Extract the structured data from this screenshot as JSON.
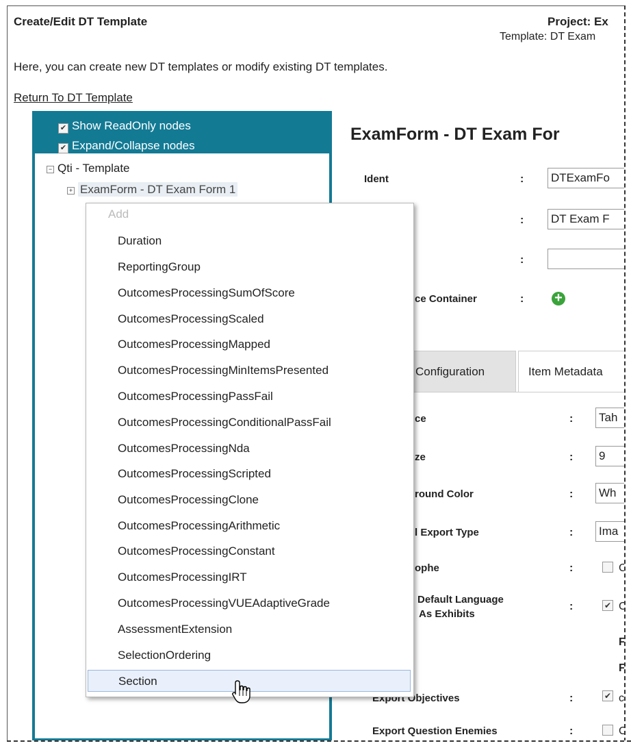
{
  "page": {
    "title": "Create/Edit DT Template",
    "project_label": "Project: Ex",
    "template_label": "Template: DT Exam",
    "description": "Here, you can create new DT templates or modify existing DT templates.",
    "return_link": "Return To DT Template"
  },
  "tree": {
    "show_readonly": "Show ReadOnly nodes",
    "expand_collapse": "Expand/Collapse nodes",
    "root_node": "Qti - Template",
    "child_node": "ExamForm - DT Exam Form 1"
  },
  "context_menu": {
    "header": "Add",
    "items": [
      "Duration",
      "ReportingGroup",
      "OutcomesProcessingSumOfScore",
      "OutcomesProcessingScaled",
      "OutcomesProcessingMapped",
      "OutcomesProcessingMinItemsPresented",
      "OutcomesProcessingPassFail",
      "OutcomesProcessingConditionalPassFail",
      "OutcomesProcessingNda",
      "OutcomesProcessingScripted",
      "OutcomesProcessingClone",
      "OutcomesProcessingArithmetic",
      "OutcomesProcessingConstant",
      "OutcomesProcessingIRT",
      "OutcomesProcessingVUEAdaptiveGrade",
      "AssessmentExtension",
      "SelectionOrdering",
      "Section"
    ]
  },
  "detail": {
    "title": "ExamForm - DT Exam For",
    "ident_label": "Ident",
    "ident_value": "DTExamFo",
    "title_value": "DT Exam F",
    "container_label": "ce Container",
    "colon": ":",
    "tabs": [
      "Configuration",
      "Item Metadata"
    ],
    "config_rows": [
      {
        "label": "ce",
        "value": "Tah"
      },
      {
        "label": "ze",
        "value": "9"
      },
      {
        "label": "round Color",
        "value": "Wh"
      },
      {
        "label": "l Export Type",
        "value": "Ima"
      },
      {
        "label": "ophe",
        "value": "C"
      },
      {
        "label": "Default Language",
        "label2": "As Exhibits",
        "value": "C"
      },
      {
        "label": "Export Objectives",
        "value": "c"
      },
      {
        "label": "Export Question Enemies",
        "value": "C"
      }
    ],
    "f_letter": "F"
  }
}
